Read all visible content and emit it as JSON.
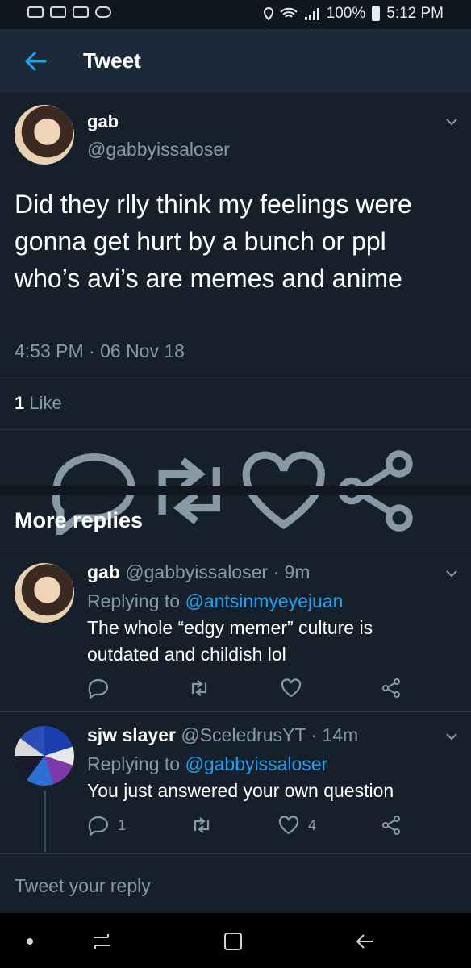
{
  "status_bar": {
    "battery": "100%",
    "time": "5:12 PM",
    "icons": [
      "chat-icon",
      "chat-icon",
      "chat-icon",
      "voicemail-icon",
      "location-icon",
      "wifi-icon",
      "signal-icon",
      "battery-icon"
    ]
  },
  "header": {
    "title": "Tweet",
    "back_icon": "arrow-left-icon"
  },
  "tweet": {
    "name": "gab",
    "handle": "@gabbyissaloser",
    "text": "Did they rlly think my feelings were gonna get hurt by a bunch or ppl who’s avi’s are memes and anime",
    "timestamp": "4:53 PM · 06 Nov 18",
    "likes_count": "1",
    "likes_label": "Like"
  },
  "section": {
    "more_replies": "More replies"
  },
  "replies": [
    {
      "name": "gab",
      "handle": "@gabbyissaloser",
      "age": "· 9m",
      "replying_prefix": "Replying to",
      "replying_to": "@antsinmyeyejuan",
      "text": "The whole “edgy memer” culture is outdated and childish lol",
      "reply_count": "",
      "like_count": ""
    },
    {
      "name": "sjw slayer",
      "handle": "@SceledrusYT",
      "age": "· 14m",
      "replying_prefix": "Replying to",
      "replying_to": "@gabbyissaloser",
      "text": "You just answered your own question",
      "reply_count": "1",
      "like_count": "4"
    }
  ],
  "composer": {
    "placeholder": "Tweet your reply"
  },
  "colors": {
    "background": "#15202b",
    "accent": "#1da1f2",
    "muted": "#8899a6"
  }
}
